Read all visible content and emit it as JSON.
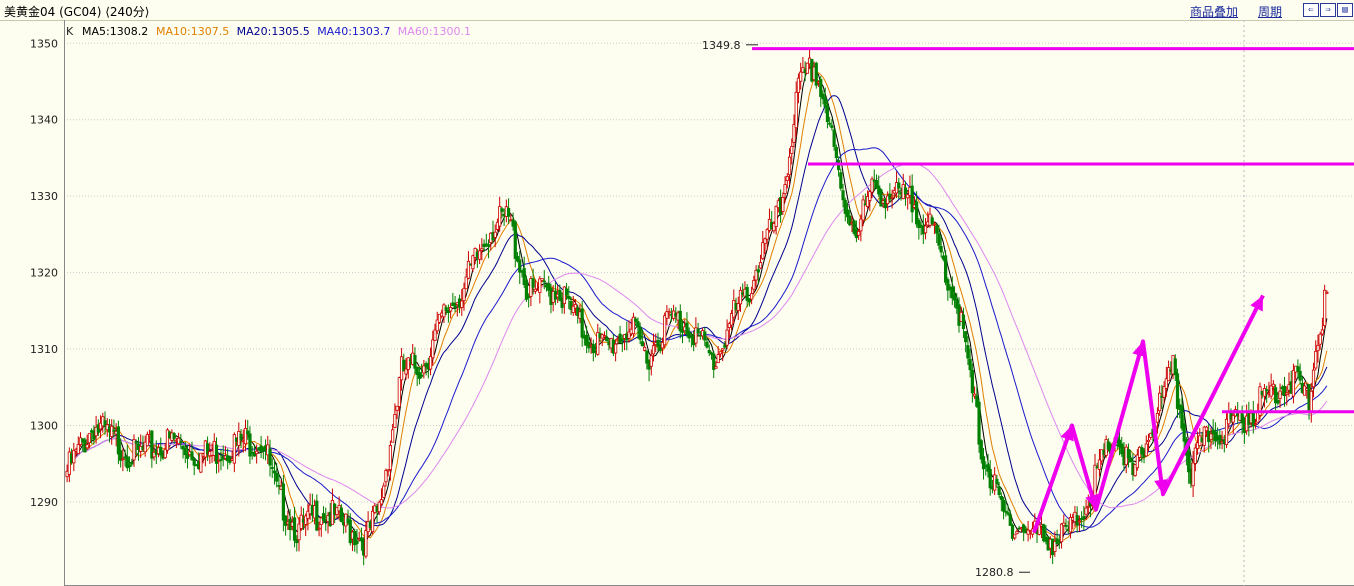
{
  "header": {
    "title": "美黄金04 (GC04) ⟨240分⟩",
    "overlay_label": "商品叠加",
    "period_label": "周期",
    "nav_left": "⇐",
    "nav_right": "⇒",
    "nav_panel": "▤"
  },
  "colors": {
    "background": "#fdfdf0",
    "up": "#cc0000",
    "down": "#008000",
    "ma5": "#000000",
    "ma10": "#e08000",
    "ma20": "#000090",
    "ma40": "#1a1acc",
    "ma60": "#dd88ee",
    "annotation": "#ee00ee",
    "grid": "#cccccc"
  },
  "chart_data": {
    "type": "candlestick",
    "legend_prefix": "K",
    "legend": [
      {
        "label": "MA5:1308.2",
        "color": "#000000"
      },
      {
        "label": "MA10:1307.5",
        "color": "#e08000"
      },
      {
        "label": "MA20:1305.5",
        "color": "#000090"
      },
      {
        "label": "MA40:1303.7",
        "color": "#1a1acc"
      },
      {
        "label": "MA60:1300.1",
        "color": "#dd88ee"
      }
    ],
    "ylim": [
      1279,
      1352
    ],
    "y_ticks": [
      1290,
      1300,
      1310,
      1320,
      1330,
      1340,
      1350
    ],
    "grid": true,
    "price_path": [
      [
        0,
        1294
      ],
      [
        12,
        1300
      ],
      [
        30,
        1296
      ],
      [
        48,
        1298
      ],
      [
        60,
        1296
      ],
      [
        80,
        1298
      ],
      [
        88,
        1298
      ],
      [
        94,
        1291
      ],
      [
        104,
        1286
      ],
      [
        114,
        1289
      ],
      [
        124,
        1287
      ],
      [
        134,
        1285
      ],
      [
        140,
        1289
      ],
      [
        150,
        1307
      ],
      [
        160,
        1308
      ],
      [
        170,
        1315
      ],
      [
        178,
        1318
      ],
      [
        190,
        1326
      ],
      [
        198,
        1327
      ],
      [
        207,
        1317
      ],
      [
        220,
        1318
      ],
      [
        232,
        1312
      ],
      [
        242,
        1310
      ],
      [
        252,
        1313
      ],
      [
        260,
        1309
      ],
      [
        270,
        1314
      ],
      [
        280,
        1313
      ],
      [
        290,
        1308
      ],
      [
        298,
        1314
      ],
      [
        305,
        1317
      ],
      [
        312,
        1323
      ],
      [
        320,
        1328
      ],
      [
        328,
        1344
      ],
      [
        335,
        1347
      ],
      [
        340,
        1342
      ],
      [
        348,
        1329
      ],
      [
        354,
        1326
      ],
      [
        362,
        1331
      ],
      [
        370,
        1330
      ],
      [
        380,
        1329
      ],
      [
        390,
        1324
      ],
      [
        400,
        1315
      ],
      [
        410,
        1297
      ],
      [
        420,
        1288
      ],
      [
        432,
        1286
      ],
      [
        445,
        1285
      ],
      [
        452,
        1287
      ],
      [
        460,
        1292
      ],
      [
        470,
        1299
      ],
      [
        478,
        1293
      ],
      [
        488,
        1301
      ],
      [
        496,
        1307
      ],
      [
        504,
        1294
      ],
      [
        512,
        1299
      ],
      [
        522,
        1300
      ],
      [
        532,
        1302
      ],
      [
        542,
        1305
      ],
      [
        550,
        1306
      ],
      [
        557,
        1303
      ],
      [
        561,
        1312
      ],
      [
        565,
        1317
      ]
    ],
    "ma_specs": [
      5,
      10,
      20,
      40,
      60
    ],
    "annotations": {
      "high_label": "1349.8",
      "high_value": 1349.8,
      "low_label": "1280.8",
      "low_value": 1280.8,
      "horizontal_lines": [
        1349.3,
        1334.2,
        1301.8
      ],
      "arrow_path": [
        [
          1283.5,
          1300.8
        ],
        [
          1290.6,
          1312.2
        ],
        [
          1291.2,
          1318.0
        ]
      ]
    }
  }
}
